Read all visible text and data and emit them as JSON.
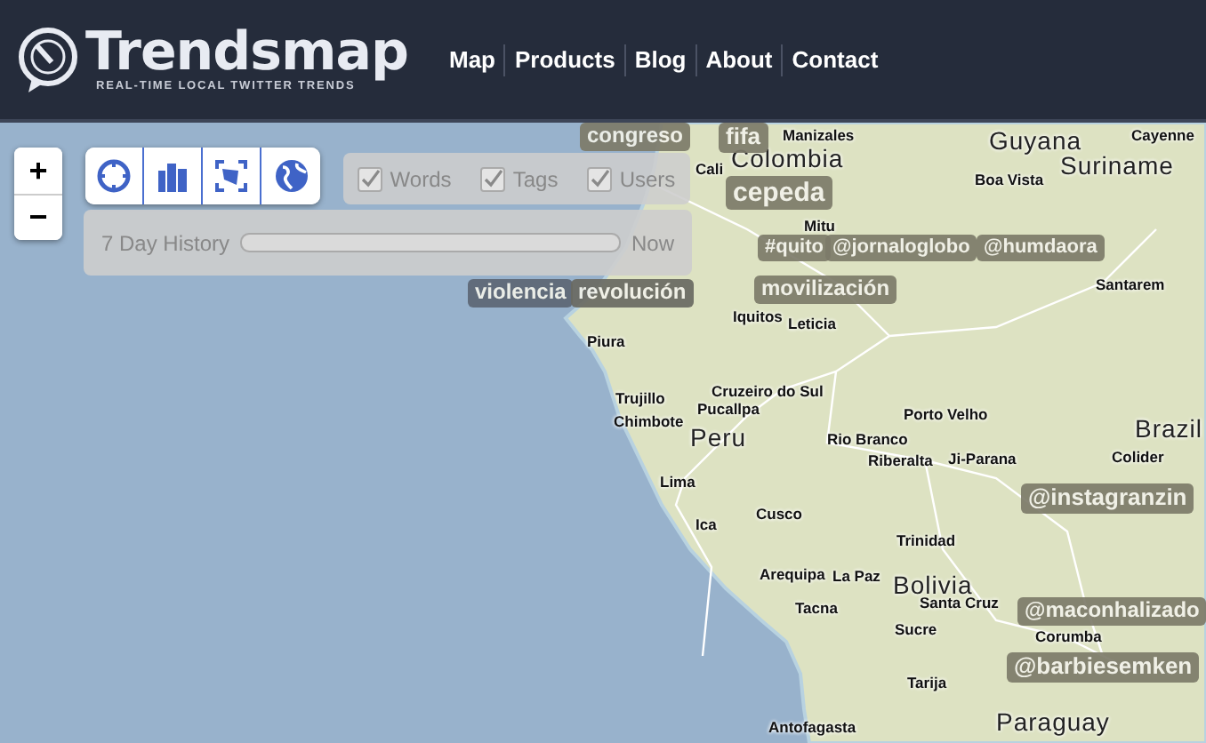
{
  "header": {
    "logo_title": "Trendsmap",
    "logo_tagline": "REAL-TIME LOCAL TWITTER TRENDS",
    "nav": [
      "Map",
      "Products",
      "Blog",
      "About",
      "Contact"
    ]
  },
  "map_controls": {
    "zoom": [
      "+",
      "−"
    ],
    "filters": [
      {
        "label": "Words",
        "checked": true
      },
      {
        "label": "Tags",
        "checked": true
      },
      {
        "label": "Users",
        "checked": true
      }
    ],
    "history": {
      "label": "7 Day History",
      "end_label": "Now",
      "level": 1
    }
  },
  "places": [
    {
      "name": "Manizales",
      "kind": "city"
    },
    {
      "name": "Cali",
      "kind": "city"
    },
    {
      "name": "Colombia",
      "kind": "country"
    },
    {
      "name": "Mitu",
      "kind": "city"
    },
    {
      "name": "Guyana",
      "kind": "country"
    },
    {
      "name": "Suriname",
      "kind": "country"
    },
    {
      "name": "Cayenne",
      "kind": "city"
    },
    {
      "name": "Boa Vista",
      "kind": "city"
    },
    {
      "name": "Santarem",
      "kind": "city"
    },
    {
      "name": "Iquitos",
      "kind": "city"
    },
    {
      "name": "Leticia",
      "kind": "city"
    },
    {
      "name": "Piura",
      "kind": "city"
    },
    {
      "name": "Trujillo",
      "kind": "city"
    },
    {
      "name": "Chimbote",
      "kind": "city"
    },
    {
      "name": "Cruzeiro do Sul",
      "kind": "city"
    },
    {
      "name": "Pucallpa",
      "kind": "city"
    },
    {
      "name": "Peru",
      "kind": "country"
    },
    {
      "name": "Porto Velho",
      "kind": "city"
    },
    {
      "name": "Rio Branco",
      "kind": "city"
    },
    {
      "name": "Riberalta",
      "kind": "city"
    },
    {
      "name": "Ji-Parana",
      "kind": "city"
    },
    {
      "name": "Brazil",
      "kind": "country"
    },
    {
      "name": "Colider",
      "kind": "city"
    },
    {
      "name": "Lima",
      "kind": "city"
    },
    {
      "name": "Ica",
      "kind": "city"
    },
    {
      "name": "Cusco",
      "kind": "city"
    },
    {
      "name": "Trinidad",
      "kind": "city"
    },
    {
      "name": "Arequipa",
      "kind": "city"
    },
    {
      "name": "La Paz",
      "kind": "city"
    },
    {
      "name": "Bolivia",
      "kind": "country"
    },
    {
      "name": "Santa Cruz",
      "kind": "city"
    },
    {
      "name": "Tacna",
      "kind": "city"
    },
    {
      "name": "Sucre",
      "kind": "city"
    },
    {
      "name": "Corumba",
      "kind": "city"
    },
    {
      "name": "Tarija",
      "kind": "city"
    },
    {
      "name": "Antofagasta",
      "kind": "city"
    },
    {
      "name": "Paraguay",
      "kind": "country"
    }
  ],
  "trends": [
    {
      "text": "congreso",
      "color": "#7d7b6a"
    },
    {
      "text": "fifa",
      "color": "#7d7b6a"
    },
    {
      "text": "cepeda",
      "color": "#7d7b6a"
    },
    {
      "text": "#quito",
      "color": "#7d7b6a"
    },
    {
      "text": "@jornaloglobo",
      "color": "#7d7b6a"
    },
    {
      "text": "@humdaora",
      "color": "#7d7b6a"
    },
    {
      "text": "violencia",
      "color": "#5d6775"
    },
    {
      "text": "revolución",
      "color": "#6a6a62"
    },
    {
      "text": "movilización",
      "color": "#7d7b6a"
    },
    {
      "text": "@instagranzin",
      "color": "#7d7b6a"
    },
    {
      "text": "@maconhalizado",
      "color": "#7d7b6a"
    },
    {
      "text": "@barbiesemken",
      "color": "#7d7b6a"
    }
  ]
}
